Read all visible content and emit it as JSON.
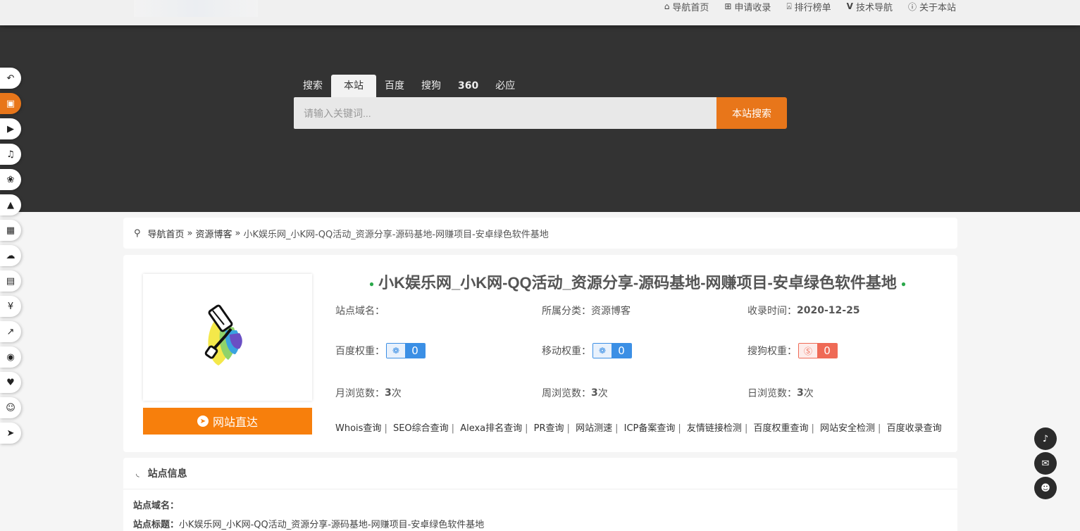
{
  "topnav": [
    {
      "icon": "home-icon",
      "glyph": "⌂",
      "label": "导航首页"
    },
    {
      "icon": "plus-square-icon",
      "glyph": "⊞",
      "label": "申请收录"
    },
    {
      "icon": "ranking-icon",
      "glyph": "⍓",
      "label": "排行榜单"
    },
    {
      "icon": "vimeo-icon",
      "glyph": "V",
      "label": "技术导航"
    },
    {
      "icon": "info-icon",
      "glyph": "ⓘ",
      "label": "关于本站"
    }
  ],
  "search": {
    "tabs": [
      "搜索",
      "本站",
      "百度",
      "搜狗",
      "360",
      "必应"
    ],
    "active_tab": "本站",
    "placeholder": "请输入关键词...",
    "button_label": "本站搜索"
  },
  "rail": [
    {
      "icon": "back-icon",
      "glyph": "↶"
    },
    {
      "icon": "train-icon",
      "glyph": "▣"
    },
    {
      "icon": "video-icon",
      "glyph": "▶"
    },
    {
      "icon": "music-icon",
      "glyph": "♫"
    },
    {
      "icon": "games-icon",
      "glyph": "❀"
    },
    {
      "icon": "graduation-icon",
      "glyph": "▲"
    },
    {
      "icon": "apps-icon",
      "glyph": "▦"
    },
    {
      "icon": "cloud-icon",
      "glyph": "☁"
    },
    {
      "icon": "document-icon",
      "glyph": "▤"
    },
    {
      "icon": "yen-icon",
      "glyph": "¥"
    },
    {
      "icon": "chart-icon",
      "glyph": "↗"
    },
    {
      "icon": "compass-icon",
      "glyph": "◉"
    },
    {
      "icon": "heartbeat-icon",
      "glyph": "♥"
    },
    {
      "icon": "firefox-icon",
      "glyph": "☺"
    },
    {
      "icon": "send-icon",
      "glyph": "➤"
    }
  ],
  "breadcrumb": {
    "icon": "filter-icon",
    "home": "导航首页",
    "separator": "»",
    "category": "资源博客",
    "current": "小K娱乐网_小K网-QQ活动_资源分享-源码基地-网赚项目-安卓绿色软件基地"
  },
  "site": {
    "title": "小K娱乐网_小K网-QQ活动_资源分享-源码基地-网赚项目-安卓绿色软件基地",
    "visit_label": "网站直达",
    "domain_label": "站点域名：",
    "domain_value": "",
    "category_label": "所属分类：",
    "category_value": "资源博客",
    "date_label": "收录时间：",
    "date_value": "2020-12-25",
    "baidu_label": "百度权重：",
    "baidu_value": "0",
    "mobile_label": "移动权重：",
    "mobile_value": "0",
    "sogou_label": "搜狗权重：",
    "sogou_value": "0",
    "monthly_label": "月浏览数：",
    "monthly_value": "3",
    "weekly_label": "周浏览数：",
    "weekly_value": "3",
    "daily_label": "日浏览数：",
    "daily_value": "3",
    "views_unit": "次",
    "tools": [
      "Whois查询",
      "SEO综合查询",
      "Alexa排名查询",
      "PR查询",
      "网站测速",
      "ICP备案查询",
      "友情链接检测",
      "百度权重查询",
      "网站安全检测",
      "百度收录查询"
    ]
  },
  "info": {
    "heading": "站点信息",
    "domain_label": "站点域名：",
    "domain_value": "",
    "title_label": "站点标题：",
    "title_value": "小K娱乐网_小K网-QQ活动_资源分享-源码基地-网赚项目-安卓绿色软件基地"
  },
  "colors": {
    "accent": "#e8761a",
    "hero_bg": "#333333",
    "badge_blue": "#3b8fe5",
    "badge_red": "#ef6a56"
  }
}
